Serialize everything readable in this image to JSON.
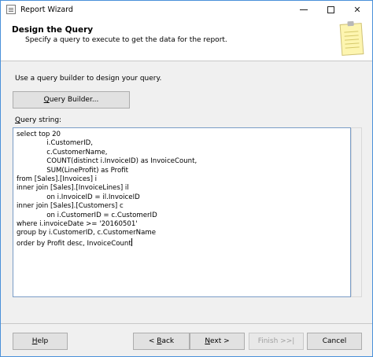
{
  "window": {
    "title": "Report Wizard",
    "controls": {
      "minimize": "minimize",
      "maximize": "maximize",
      "close": "✕"
    }
  },
  "header": {
    "title": "Design the Query",
    "subtitle": "Specify a query to execute to get the data for the report."
  },
  "main": {
    "instructions": "Use a query builder to design your query.",
    "query_builder_button": "Query Builder...",
    "query_label": "Query string:",
    "query_lines": [
      "select top 20",
      "              i.CustomerID,",
      "              c.CustomerName,",
      "              COUNT(distinct i.InvoiceID) as InvoiceCount,",
      "              SUM(LineProfit) as Profit",
      "from [Sales].[Invoices] i",
      "inner join [Sales].[InvoiceLines] il",
      "              on i.InvoiceID = il.InvoiceID",
      "inner join [Sales].[Customers] c",
      "              on i.CustomerID = c.CustomerID",
      "where i.invoiceDate >= '20160501'",
      "group by i.CustomerID, c.CustomerName",
      "order by Profit desc, InvoiceCount"
    ]
  },
  "footer": {
    "help": "Help",
    "back": "< Back",
    "next": "Next >",
    "finish": "Finish >>|",
    "cancel": "Cancel"
  }
}
